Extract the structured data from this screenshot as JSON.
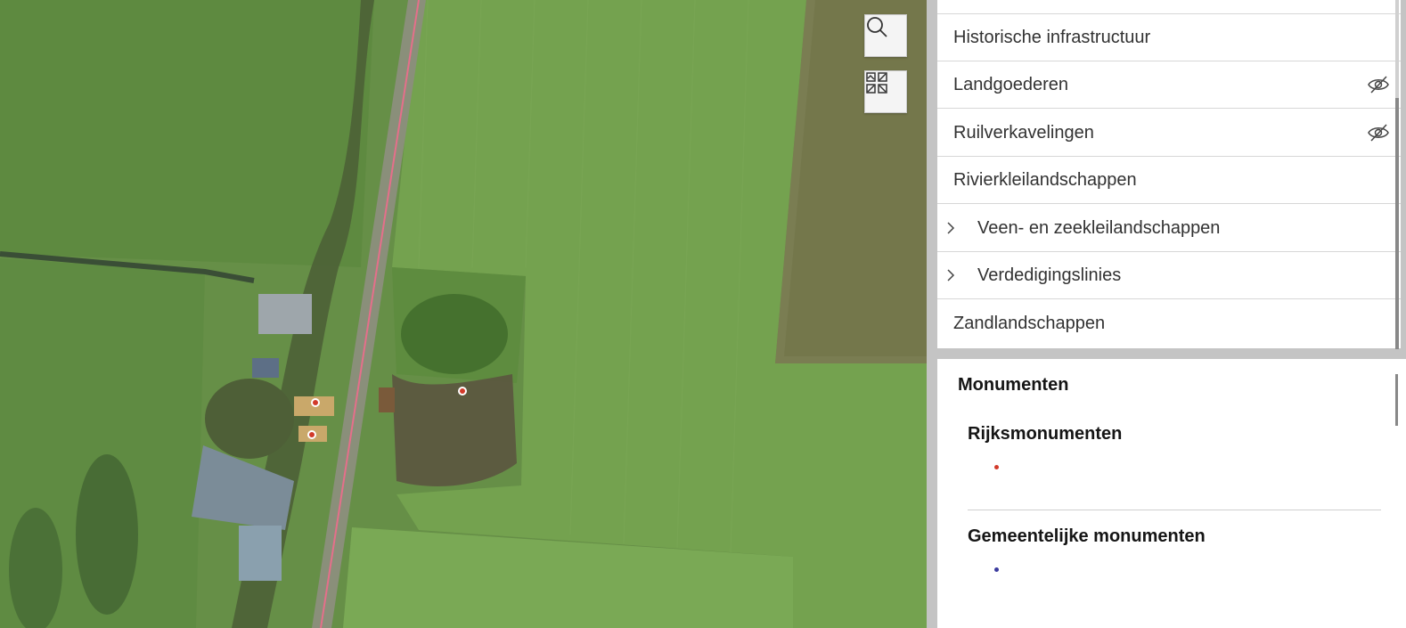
{
  "map": {
    "search_icon": "search-icon",
    "widgets_icon": "basemap-gallery-icon",
    "monument_marker_color": "#d23a2a"
  },
  "layer_list": {
    "items": [
      {
        "label": "Historische infrastructuur",
        "visible": true,
        "expandable": false
      },
      {
        "label": "Landgoederen",
        "visible": false,
        "expandable": false
      },
      {
        "label": "Ruilverkavelingen",
        "visible": false,
        "expandable": false
      },
      {
        "label": "Rivierkleilandschappen",
        "visible": true,
        "expandable": false
      },
      {
        "label": "Veen- en zeekleilandschappen",
        "visible": true,
        "expandable": true
      },
      {
        "label": "Verdedigingslinies",
        "visible": true,
        "expandable": true
      },
      {
        "label": "Zandlandschappen",
        "visible": true,
        "expandable": false
      }
    ],
    "hidden_icon": "eye-slash-icon",
    "expand_icon": "chevron-right-icon"
  },
  "legend": {
    "title": "Monumenten",
    "layers": [
      {
        "title": "Rijksmonumenten",
        "symbol_color": "#d23a2a"
      },
      {
        "title": "Gemeentelijke monumenten",
        "symbol_color": "#3b3b9e"
      }
    ]
  }
}
